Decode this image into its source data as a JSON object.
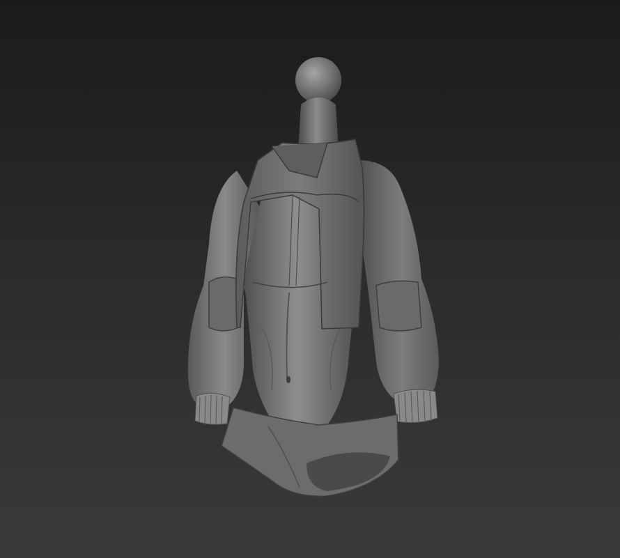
{
  "viewport": {
    "background_top": "#1b1b1b",
    "background_bottom": "#3a3a3a"
  },
  "model": {
    "subject": "sculpted-jacket-bodysuit-on-mannequin",
    "material_light": "#9a9a9a",
    "material_mid": "#6e6e6e",
    "material_dark": "#3c3c3c",
    "seam_color": "#4a4a4a"
  }
}
